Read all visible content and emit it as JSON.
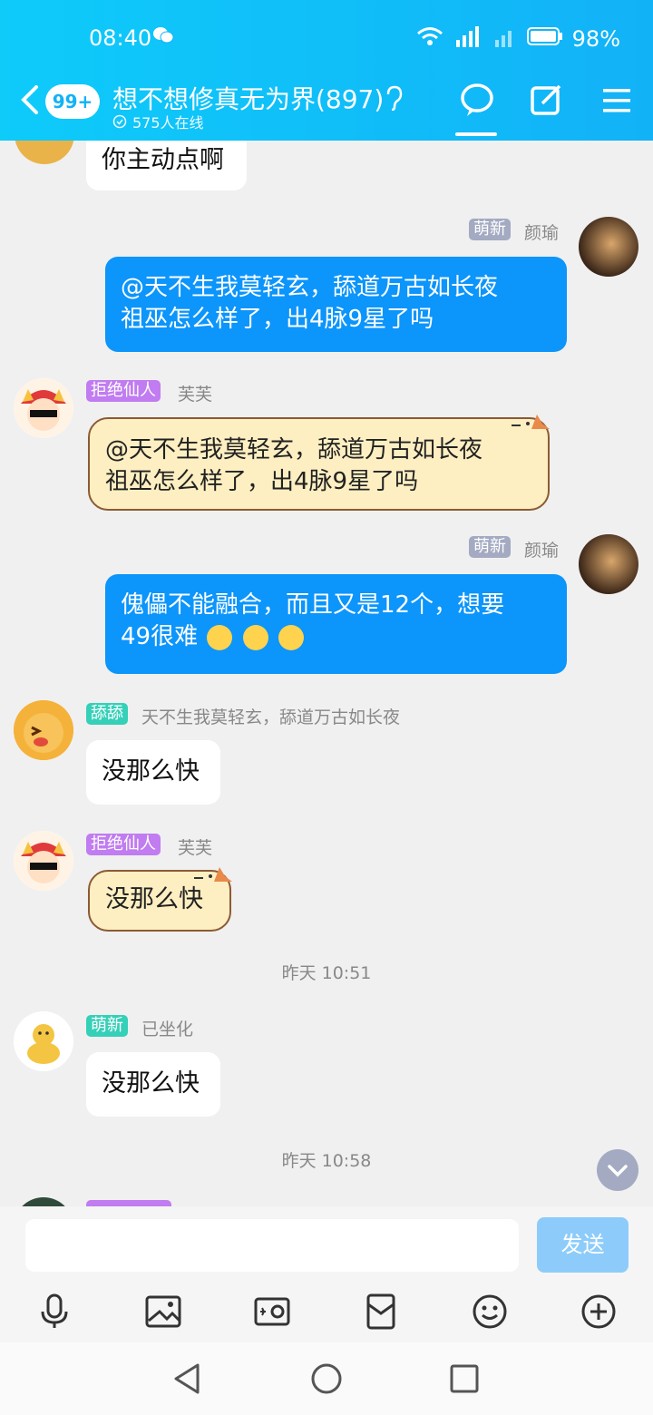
{
  "status": {
    "time": "08:40",
    "battery": "98%",
    "network": "4G"
  },
  "header": {
    "badge": "99+",
    "title": "想不想修真无为界(897)",
    "online": "575人在线"
  },
  "messages": {
    "m0": {
      "text": "你主动点啊"
    },
    "m1": {
      "tag": "萌新",
      "name": "颜瑜",
      "text": "@天不生我莫轻玄，舔道万古如长夜\n祖巫怎么样了，出4脉9星了吗"
    },
    "m2": {
      "tag": "拒绝仙人",
      "name": "芙芙",
      "text": "@天不生我莫轻玄，舔道万古如长夜\n祖巫怎么样了，出4脉9星了吗"
    },
    "m3": {
      "tag": "萌新",
      "name": "颜瑜",
      "text": "傀儡不能融合，而且又是12个，想要\n49很难"
    },
    "m4": {
      "tag": "舔舔",
      "name": "天不生我莫轻玄，舔道万古如长夜",
      "text": "没那么快"
    },
    "m5": {
      "tag": "拒绝仙人",
      "name": "芙芙",
      "text": "没那么快"
    },
    "sep1": "昨天 10:51",
    "m6": {
      "tag": "萌新",
      "name": "已坐化",
      "text": "没那么快"
    },
    "sep2": "昨天 10:58"
  },
  "input": {
    "placeholder": "",
    "send": "发送"
  },
  "colors": {
    "header": "#12b2f7",
    "bubble_blue": "#0c95fb",
    "tag_gray": "#a3aac2",
    "tag_purple": "#c07cf0",
    "tag_teal": "#35d0b8"
  },
  "icons": [
    "back-icon",
    "ear-icon",
    "chat-icon",
    "edit-icon",
    "menu-icon",
    "mic-icon",
    "image-icon",
    "camera-icon",
    "redpacket-icon",
    "emoji-icon",
    "plus-icon"
  ]
}
